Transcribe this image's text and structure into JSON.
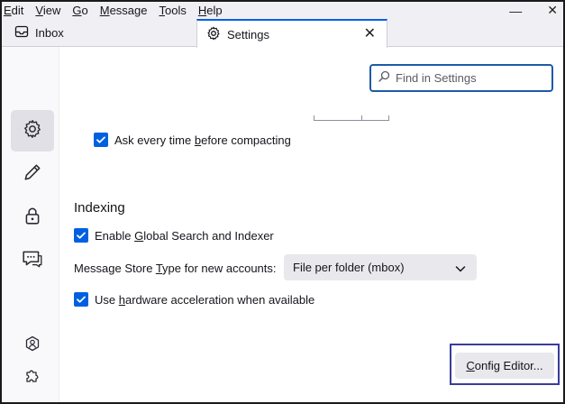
{
  "menubar": {
    "items": [
      {
        "label": "Edit",
        "accel": "E",
        "rest": "dit"
      },
      {
        "label": "View",
        "accel": "V",
        "rest": "iew"
      },
      {
        "label": "Go",
        "accel": "G",
        "rest": "o"
      },
      {
        "label": "Message",
        "accel": "M",
        "rest": "essage"
      },
      {
        "label": "Tools",
        "accel": "T",
        "rest": "ools"
      },
      {
        "label": "Help",
        "accel": "H",
        "rest": "elp"
      }
    ]
  },
  "window_controls": {
    "minimize": "—",
    "close": "✕"
  },
  "tabs": {
    "inbox": {
      "label": "Inbox",
      "icon": "inbox-icon"
    },
    "settings": {
      "label": "Settings",
      "icon": "gear-icon",
      "close": "✕"
    }
  },
  "sidebar": {
    "items": [
      {
        "name": "general",
        "icon": "gear-icon",
        "active": true
      },
      {
        "name": "composition",
        "icon": "pencil-icon",
        "active": false
      },
      {
        "name": "privacy",
        "icon": "lock-icon",
        "active": false
      },
      {
        "name": "chat",
        "icon": "chat-icon",
        "active": false
      }
    ],
    "footer": [
      {
        "name": "account-settings",
        "icon": "account-icon"
      },
      {
        "name": "addons",
        "icon": "puzzle-icon"
      }
    ]
  },
  "search": {
    "placeholder": "Find in Settings",
    "value": ""
  },
  "settings": {
    "compact": {
      "pre": "Ask every time ",
      "accel": "b",
      "post": "efore compacting",
      "checked": true
    },
    "indexing_heading": "Indexing",
    "global_search": {
      "pre": "Enable ",
      "accel": "G",
      "post": "lobal Search and Indexer",
      "checked": true
    },
    "store_type": {
      "pre": "Message Store ",
      "accel": "T",
      "post": "ype for new accounts:",
      "value": "File per folder (mbox)"
    },
    "hw_accel": {
      "pre": "Use ",
      "accel": "h",
      "post": "ardware acceleration when available",
      "checked": true
    },
    "config_editor": {
      "accel": "C",
      "post": "onfig Editor..."
    }
  },
  "colors": {
    "accent": "#0061e0",
    "frame": "#3b3b9c",
    "search_border": "#1d5aa8"
  }
}
